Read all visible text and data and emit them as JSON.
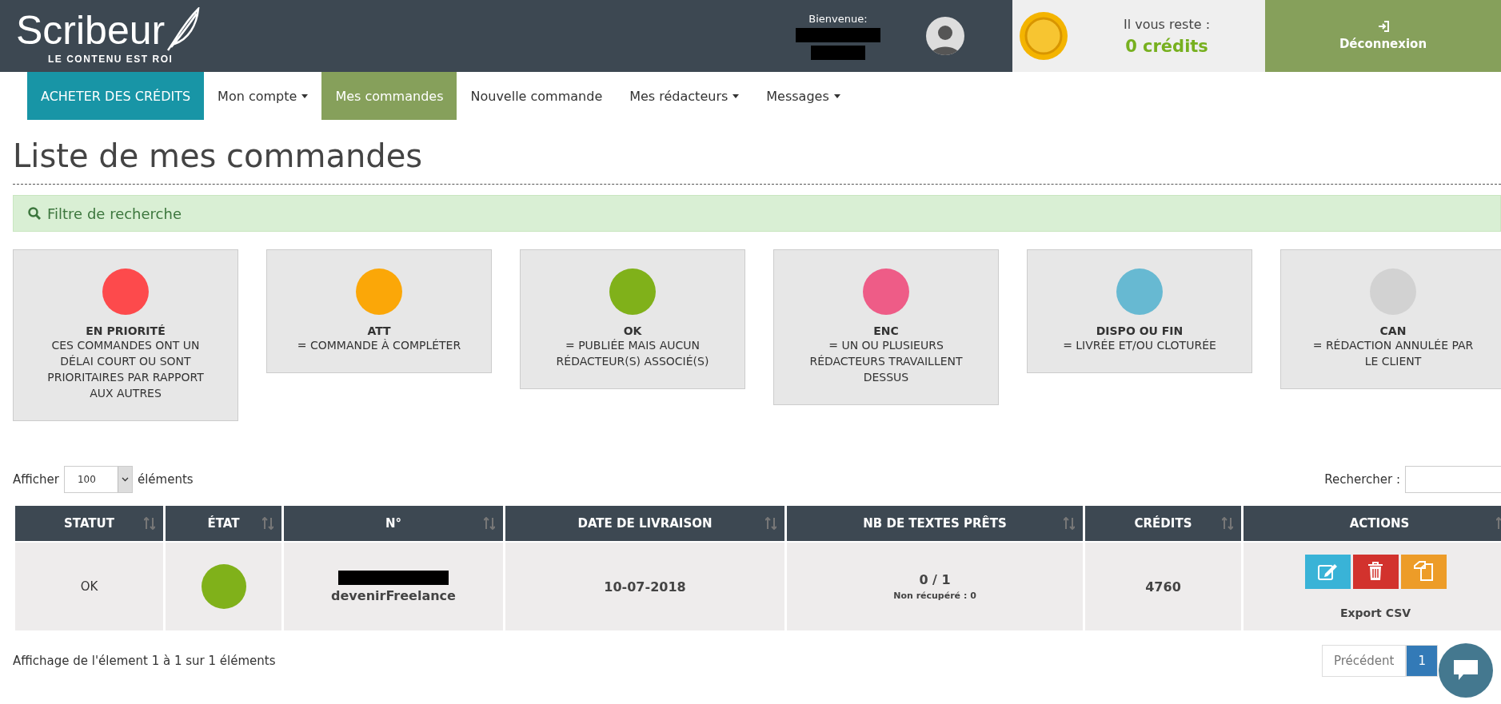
{
  "header": {
    "logo": "Scribeur",
    "tagline": "LE CONTENU EST ROI",
    "welcome": "Bienvenue:",
    "credits_label": "Il vous reste :",
    "credits_value": "0 crédits",
    "logout": "Déconnexion"
  },
  "nav": [
    {
      "label": "ACHETER DES CRÉDITS",
      "kind": "cta",
      "dropdown": false,
      "selected": false
    },
    {
      "label": "Mon compte",
      "kind": "link",
      "dropdown": true,
      "selected": false
    },
    {
      "label": "Mes commandes",
      "kind": "link",
      "dropdown": false,
      "selected": true
    },
    {
      "label": "Nouvelle commande",
      "kind": "link",
      "dropdown": false,
      "selected": false
    },
    {
      "label": "Mes rédacteurs",
      "kind": "link",
      "dropdown": true,
      "selected": false
    },
    {
      "label": "Messages",
      "kind": "link",
      "dropdown": true,
      "selected": false
    }
  ],
  "page_title": "Liste de mes commandes",
  "filter": "Filtre de recherche",
  "legend": [
    {
      "code": "EN PRIORITÉ",
      "text": "CES COMMANDES ONT UN DÉLAI COURT OU SONT PRIORITAIRES PAR RAPPORT AUX AUTRES",
      "color": "#fd4a4c"
    },
    {
      "code": "ATT",
      "text": "= COMMANDE À COMPLÉTER",
      "color": "#fba708"
    },
    {
      "code": "OK",
      "text": "= PUBLIÉE MAIS AUCUN RÉDACTEUR(S) ASSOCIÉ(S)",
      "color": "#80b11a"
    },
    {
      "code": "ENC",
      "text": "= UN OU PLUSIEURS RÉDACTEURS TRAVAILLENT DESSUS",
      "color": "#ee5c87"
    },
    {
      "code": "DISPO OU FIN",
      "text": "= LIVRÉE ET/OU CLOTURÉE",
      "color": "#67b9d2"
    },
    {
      "code": "CAN",
      "text": "= RÉDACTION ANNULÉE PAR LE CLIENT",
      "color": "#d2d2d2"
    }
  ],
  "length": {
    "label_before": "Afficher",
    "value": "100",
    "label_after": "éléments"
  },
  "search": {
    "label": "Rechercher :"
  },
  "table": {
    "columns": [
      "STATUT",
      "ÉTAT",
      "N°",
      "DATE DE LIVRAISON",
      "NB DE TEXTES PRÊTS",
      "CRÉDITS",
      "ACTIONS"
    ],
    "rows": [
      {
        "statut": "OK",
        "color": "#80b11a",
        "numero": "devenirFreelance",
        "date": "10-07-2018",
        "ready": "0 / 1",
        "not_fetched": "Non récupéré : 0",
        "credits": "4760",
        "export": "Export CSV"
      }
    ]
  },
  "info": "Affichage de l'élement 1 à 1 sur 1 éléments",
  "pagination": [
    {
      "label": "Précédent",
      "selected": false
    },
    {
      "label": "1",
      "selected": true
    }
  ]
}
